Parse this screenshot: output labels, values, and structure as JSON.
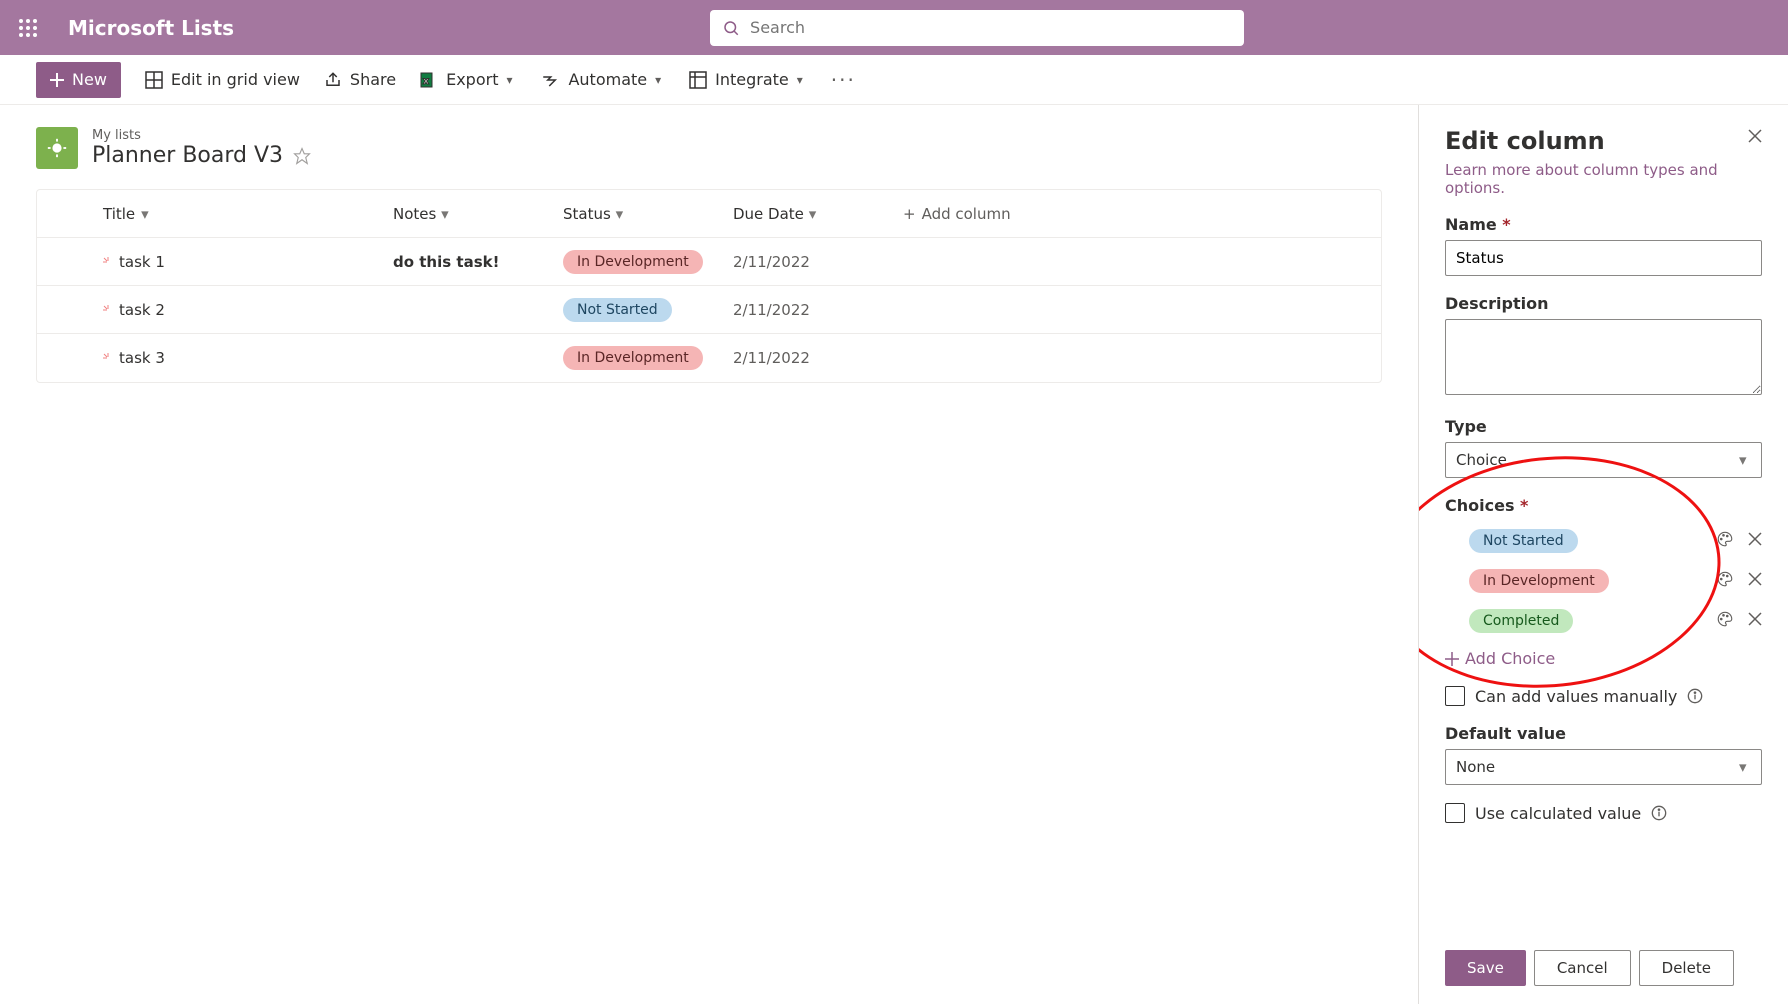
{
  "suite": {
    "app_name": "Microsoft Lists",
    "search_placeholder": "Search"
  },
  "commands": {
    "new": "New",
    "edit_grid": "Edit in grid view",
    "share": "Share",
    "export": "Export",
    "automate": "Automate",
    "integrate": "Integrate"
  },
  "list": {
    "crumb": "My lists",
    "title": "Planner Board V3"
  },
  "columns": {
    "title": "Title",
    "notes": "Notes",
    "status": "Status",
    "due": "Due Date",
    "add": "Add column"
  },
  "rows": [
    {
      "title": "task 1",
      "notes": "do this task!",
      "status": "In Development",
      "status_class": "dev",
      "due": "2/11/2022"
    },
    {
      "title": "task 2",
      "notes": "",
      "status": "Not Started",
      "status_class": "ns",
      "due": "2/11/2022"
    },
    {
      "title": "task 3",
      "notes": "",
      "status": "In Development",
      "status_class": "dev",
      "due": "2/11/2022"
    }
  ],
  "panel": {
    "title": "Edit column",
    "learn": "Learn more about column types and options.",
    "name_label": "Name",
    "name_value": "Status",
    "desc_label": "Description",
    "desc_value": "",
    "type_label": "Type",
    "type_value": "Choice",
    "choices_label": "Choices",
    "choices": [
      {
        "label": "Not Started",
        "class": "ns"
      },
      {
        "label": "In Development",
        "class": "dev"
      },
      {
        "label": "Completed",
        "class": "done"
      }
    ],
    "add_choice": "Add Choice",
    "manual_label": "Can add values manually",
    "default_label": "Default value",
    "default_value": "None",
    "calc_label": "Use calculated value",
    "save": "Save",
    "cancel": "Cancel",
    "delete": "Delete"
  }
}
